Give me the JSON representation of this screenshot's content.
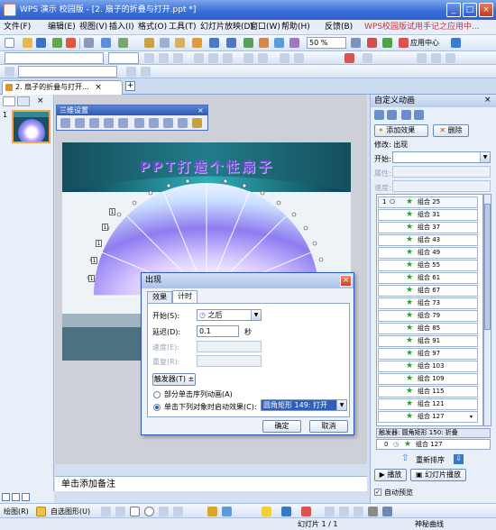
{
  "window": {
    "title": "WPS 演示 校园版 - [2. 扇子的折叠与打开.ppt *]",
    "min": "_",
    "max": "□",
    "close": "×"
  },
  "menu": {
    "items": [
      "文件(F)",
      "编辑(E)",
      "视图(V)",
      "插入(I)",
      "格式(O)",
      "工具(T)",
      "幻灯片放映(D)",
      "窗口(W)",
      "帮助(H)",
      "反馈(B)"
    ],
    "ad": "WPS校园版试用手记之应用中..."
  },
  "toolbar": {
    "zoom": "50 %",
    "app_center": "应用中心"
  },
  "tabs": {
    "doc_tab": "2. 扇子的折叠与打开...",
    "add": "+"
  },
  "slide_panel": {
    "number": "1"
  },
  "slide": {
    "title": "PPT打造个性扇子"
  },
  "float_toolbar": {
    "title": "三维设置"
  },
  "notes": {
    "placeholder": "单击添加备注"
  },
  "dialog": {
    "title": "出现",
    "tab_effect": "效果",
    "tab_timing": "计时",
    "start_label": "开始(S):",
    "start_value": "之后",
    "delay_label": "延迟(D):",
    "delay_value": "0.1",
    "delay_unit": "秒",
    "speed_label": "速度(E):",
    "repeat_label": "重复(R):",
    "trigger_button": "触发器(T) ±",
    "radio_sequence": "部分单击序列动画(A)",
    "radio_on_click": "单击下列对象时启动效果(C):",
    "trigger_object": "圆角矩形 149: 打开",
    "ok": "确定",
    "cancel": "取消"
  },
  "custom_animation": {
    "title": "自定义动画",
    "add_effect": "添加效果",
    "delete": "删除",
    "modify": "修改: 出现",
    "start_label": "开始:",
    "property_label": "属性:",
    "speed_label": "速度:",
    "first_index": "1",
    "items": [
      "组合 25",
      "组合 31",
      "组合 37",
      "组合 43",
      "组合 49",
      "组合 55",
      "组合 61",
      "组合 67",
      "组合 73",
      "组合 79",
      "组合 85",
      "组合 91",
      "组合 97",
      "组合 103",
      "组合 109",
      "组合 115",
      "组合 121",
      "组合 127"
    ],
    "trigger_label": "触发器: 圆角矩形 150: 折叠",
    "trigger_index": "0",
    "trigger_item": "组合 127",
    "reorder": "重新排序",
    "play": "播放",
    "slideshow": "幻灯片播放",
    "autopreview": "自动预览"
  },
  "drawing_toolbar": {
    "draw": "绘图(R)",
    "autoshape": "自选图形(U)"
  },
  "status": {
    "slide": "幻灯片 1 / 1",
    "theme": "神秘曲线"
  }
}
